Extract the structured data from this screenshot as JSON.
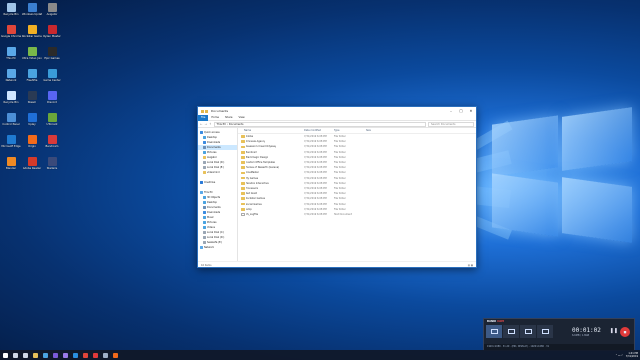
{
  "colors": {
    "wallpaper_dark": "#041c45",
    "wallpaper_light": "#5fb0ff",
    "accent": "#1979ca",
    "folder": "#e8c15a",
    "record": "#e03a3a"
  },
  "desktop": {
    "icons": [
      {
        "label": "Recycle Bin",
        "icon": "recycle-bin-icon",
        "color": "#9fc4e8"
      },
      {
        "label": "Google Chrome",
        "icon": "chrome-icon",
        "color": "#e0463a"
      },
      {
        "label": "This PC",
        "icon": "computer-icon",
        "color": "#5aa8e8"
      },
      {
        "label": "Network",
        "icon": "network-icon",
        "color": "#5aa8e8"
      },
      {
        "label": "Recycle Bin",
        "icon": "recycle-bin-icon",
        "color": "#cfe6ff"
      },
      {
        "label": "Control Panel",
        "icon": "control-panel-icon",
        "color": "#4c8fd6"
      },
      {
        "label": "Microsoft Edge",
        "icon": "edge-icon",
        "color": "#1f7ad0"
      },
      {
        "label": "Blender",
        "icon": "blender-icon",
        "color": "#f08a24"
      },
      {
        "label": "Windows Update",
        "icon": "settings-icon",
        "color": "#3b7fd0"
      },
      {
        "label": "Rockstar Games",
        "icon": "rockstar-icon",
        "color": "#f2b024"
      },
      {
        "label": "Ultra Video Joiner",
        "icon": "video-icon",
        "color": "#7ab84a"
      },
      {
        "label": "Flashfile",
        "icon": "file-icon",
        "color": "#4aa3e0"
      },
      {
        "label": "Steam",
        "icon": "steam-icon",
        "color": "#2a3a54"
      },
      {
        "label": "Uplay",
        "icon": "uplay-icon",
        "color": "#1f6fd8"
      },
      {
        "label": "Origin",
        "icon": "origin-icon",
        "color": "#f26a1b"
      },
      {
        "label": "Adobe Reader",
        "icon": "reader-icon",
        "color": "#d43a2a"
      },
      {
        "label": "Avigator",
        "icon": "app-icon",
        "color": "#8a8a8a"
      },
      {
        "label": "Ryzen Master",
        "icon": "ryzen-icon",
        "color": "#c8282e"
      },
      {
        "label": "Epic Games",
        "icon": "epic-icon",
        "color": "#2a2a2a"
      },
      {
        "label": "Game Center",
        "icon": "game-icon",
        "color": "#3a9bd8"
      },
      {
        "label": "Discord",
        "icon": "discord-icon",
        "color": "#5865f2"
      },
      {
        "label": "UTorrent",
        "icon": "torrent-icon",
        "color": "#6aa63a"
      },
      {
        "label": "Bandicam",
        "icon": "bandicam-icon",
        "color": "#d83a3a"
      },
      {
        "label": "Stellaris",
        "icon": "game-icon",
        "color": "#3a4a7a"
      }
    ]
  },
  "explorer": {
    "title": "Documents",
    "ribbon": [
      "File",
      "Home",
      "Share",
      "View"
    ],
    "path": "This PC  ›  Documents",
    "search_placeholder": "Search Documents",
    "nav": [
      {
        "label": "Quick access",
        "color": "#3b8be0",
        "selected": false
      },
      {
        "label": "Desktop",
        "color": "#4aa3e0",
        "selected": false
      },
      {
        "label": "Downloads",
        "color": "#3b8be0",
        "selected": false
      },
      {
        "label": "Documents",
        "color": "#6a8fb8",
        "selected": true
      },
      {
        "label": "Pictures",
        "color": "#4aa3e0",
        "selected": false
      },
      {
        "label": "Avigator",
        "color": "#e8c15a",
        "selected": false
      },
      {
        "label": "Local Disk (D:)",
        "color": "#9aa6b4",
        "selected": false
      },
      {
        "label": "Local Disk (E:)",
        "color": "#9aa6b4",
        "selected": false
      },
      {
        "label": "videomind",
        "color": "#e8c15a",
        "selected": false
      },
      {
        "label": "",
        "color": "#ffffff",
        "selected": false
      },
      {
        "label": "OneDrive",
        "color": "#2a7ad8",
        "selected": false
      },
      {
        "label": "",
        "color": "#ffffff",
        "selected": false
      },
      {
        "label": "This PC",
        "color": "#5aa8e8",
        "selected": false
      },
      {
        "label": "3D Objects",
        "color": "#4aa3e0",
        "selected": false
      },
      {
        "label": "Desktop",
        "color": "#4aa3e0",
        "selected": false
      },
      {
        "label": "Documents",
        "color": "#6a8fb8",
        "selected": false
      },
      {
        "label": "Downloads",
        "color": "#3b8be0",
        "selected": false
      },
      {
        "label": "Music",
        "color": "#4aa3e0",
        "selected": false
      },
      {
        "label": "Pictures",
        "color": "#4aa3e0",
        "selected": false
      },
      {
        "label": "Videos",
        "color": "#4aa3e0",
        "selected": false
      },
      {
        "label": "Local Disk (C:)",
        "color": "#9aa6b4",
        "selected": false
      },
      {
        "label": "Local Disk (D:)",
        "color": "#9aa6b4",
        "selected": false
      },
      {
        "label": "SeaGaTe (E:)",
        "color": "#9aa6b4",
        "selected": false
      },
      {
        "label": "Network",
        "color": "#5aa8e8",
        "selected": false
      }
    ],
    "columns": {
      "name": "Name",
      "date": "Date modified",
      "type": "Type",
      "size": "Size"
    },
    "files": [
      {
        "name": "Adobe",
        "date": "7/31/2019 6:08 PM",
        "type": "File folder"
      },
      {
        "name": "Amnesia Agency",
        "date": "7/31/2019 6:08 PM",
        "type": "File folder"
      },
      {
        "name": "Assassin's Creed Odyssey",
        "date": "7/31/2019 6:08 PM",
        "type": "File folder"
      },
      {
        "name": "Bandicam",
        "date": "7/31/2019 6:08 PM",
        "type": "File folder"
      },
      {
        "name": "Blackmagic Design",
        "date": "7/31/2019 6:08 PM",
        "type": "File folder"
      },
      {
        "name": "Custom Office Templates",
        "date": "7/31/2019 6:08 PM",
        "type": "File folder"
      },
      {
        "name": "Heroes of Newerth (Garena)",
        "date": "7/31/2019 6:08 PM",
        "type": "File folder"
      },
      {
        "name": "KineMaster",
        "date": "7/31/2019 6:08 PM",
        "type": "File folder"
      },
      {
        "name": "My Games",
        "date": "7/31/2019 6:08 PM",
        "type": "File folder"
      },
      {
        "name": "Paradox Interactive",
        "date": "7/31/2019 6:08 PM",
        "type": "File folder"
      },
      {
        "name": "Processors",
        "date": "7/31/2019 6:08 PM",
        "type": "File folder"
      },
      {
        "name": "Red Giant",
        "date": "7/31/2019 6:08 PM",
        "type": "File folder"
      },
      {
        "name": "Rockstar Games",
        "date": "7/31/2019 6:08 PM",
        "type": "File folder"
      },
      {
        "name": "Social Games",
        "date": "7/31/2019 6:08 PM",
        "type": "File folder"
      },
      {
        "name": "temp",
        "date": "7/31/2019 6:08 PM",
        "type": "File folder"
      },
      {
        "name": "CS_LogFile",
        "date": "7/31/2019 6:08 PM",
        "type": "Text Document"
      }
    ],
    "status_items": "16 items"
  },
  "taskbar": {
    "apps": [
      {
        "icon": "start-icon",
        "color": "#ffffff"
      },
      {
        "icon": "search-icon",
        "color": "#cfd8e6"
      },
      {
        "icon": "task-view-icon",
        "color": "#cfd8e6"
      },
      {
        "icon": "file-explorer-icon",
        "color": "#e8c15a"
      },
      {
        "icon": "store-icon",
        "color": "#4aa3e0"
      },
      {
        "icon": "premiere-icon",
        "color": "#7a5ad8"
      },
      {
        "icon": "after-effects-icon",
        "color": "#9a7ae8"
      },
      {
        "icon": "photoshop-icon",
        "color": "#2a8fe0"
      },
      {
        "icon": "chrome-icon",
        "color": "#e0463a"
      },
      {
        "icon": "bandicam-icon",
        "color": "#e03a3a"
      },
      {
        "icon": "steam-icon",
        "color": "#9fb0c8"
      },
      {
        "icon": "origin-icon",
        "color": "#f26a1b"
      }
    ],
    "time": "1:41 PM",
    "date": "7/31/2019"
  },
  "bandicam": {
    "brand": "BANDI",
    "brand_accent": "CAM",
    "modes": [
      "screen-mode-icon",
      "game-mode-icon",
      "device-mode-icon",
      "webcam-icon"
    ],
    "timer": "00:01:02",
    "size": "6.6MB / 1.8GB",
    "footer": "1920×1080 · 31,20 · (PID, DISPLAY) - 1920×1080 · 31"
  }
}
